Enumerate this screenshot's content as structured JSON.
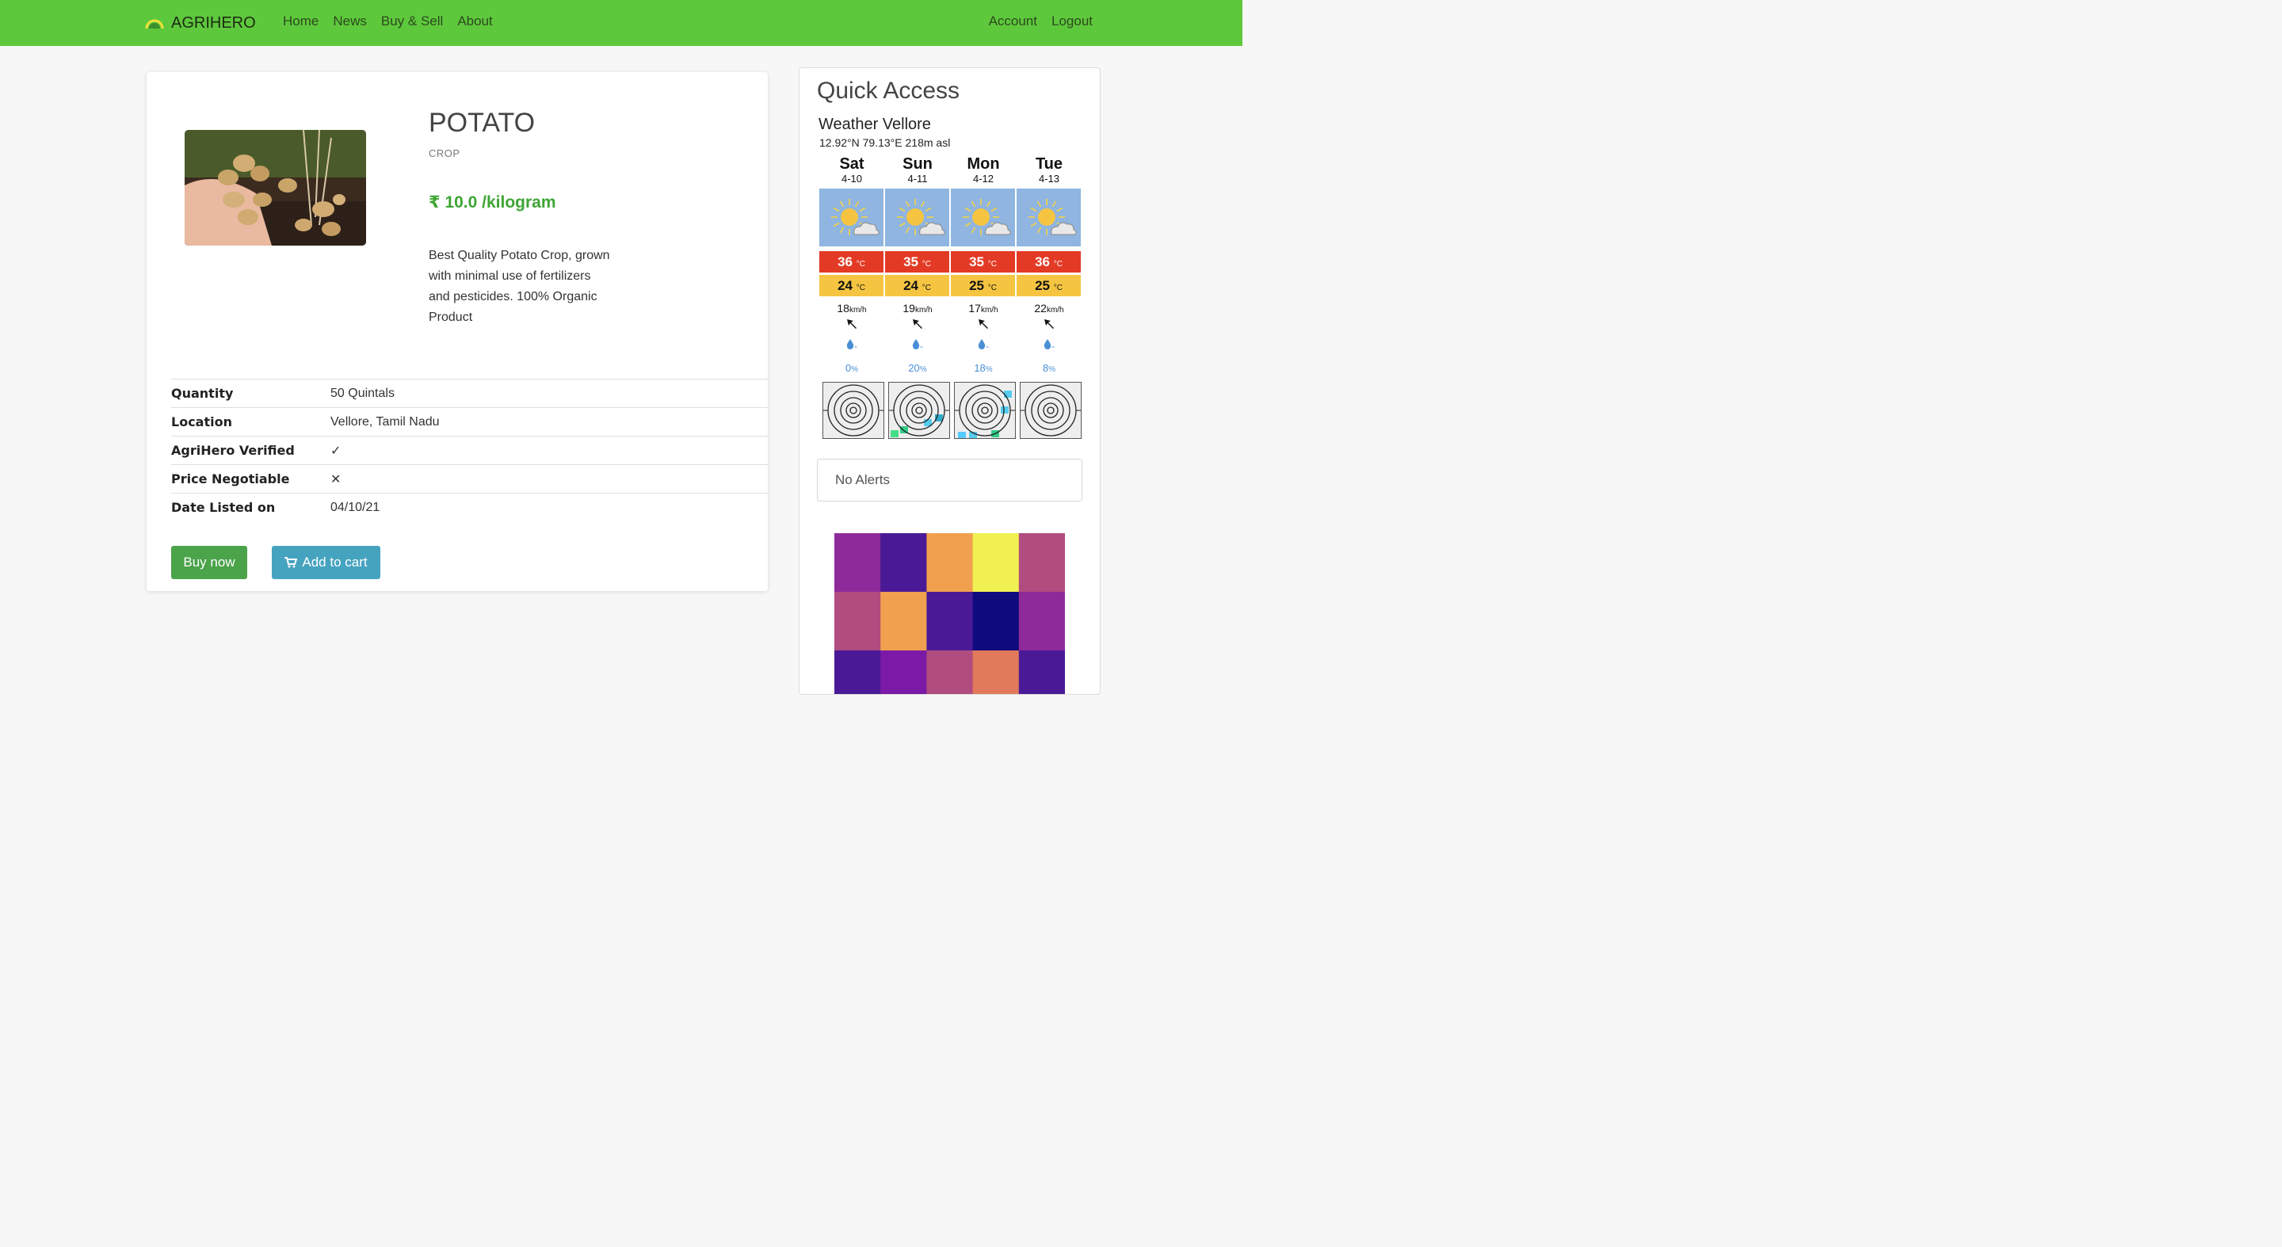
{
  "nav": {
    "brand": "AGRIHERO",
    "links": [
      "Home",
      "News",
      "Buy & Sell",
      "About"
    ],
    "right_links": [
      "Account",
      "Logout"
    ],
    "bg_color": "#5ec83d"
  },
  "product": {
    "name": "POTATO",
    "category": "CROP",
    "price": "₹ 10.0 /kilogram",
    "description": "Best Quality Potato Crop, grown with minimal use of fertilizers and pesticides. 100% Organic Product",
    "details": [
      {
        "key": "Quantity",
        "value": "50 Quintals"
      },
      {
        "key": "Location",
        "value": "Vellore, Tamil Nadu"
      },
      {
        "key": "AgriHero Verified",
        "value": "✓"
      },
      {
        "key": "Price Negotiable",
        "value": "✕"
      },
      {
        "key": "Date Listed on",
        "value": "04/10/21"
      }
    ],
    "buy_label": "Buy now",
    "cart_label": "Add to cart",
    "cart_icon": "shopping-cart-icon"
  },
  "quick_access": {
    "title": "Quick Access",
    "weather": {
      "title": "Weather Vellore",
      "coords": "12.92°N 79.13°E 218m asl",
      "temp_unit": "°C",
      "wind_unit": "km/h",
      "precip_unit": "%",
      "precip_amount": "-",
      "days": [
        {
          "day": "Sat",
          "date": "4-10",
          "max": "36",
          "min": "24",
          "wind": "18",
          "precip": "0",
          "icon": "partly-cloudy-sun-icon"
        },
        {
          "day": "Sun",
          "date": "4-11",
          "max": "35",
          "min": "24",
          "wind": "19",
          "precip": "20",
          "icon": "partly-cloudy-sun-icon"
        },
        {
          "day": "Mon",
          "date": "4-12",
          "max": "35",
          "min": "25",
          "wind": "17",
          "precip": "18",
          "icon": "partly-cloudy-sun-icon"
        },
        {
          "day": "Tue",
          "date": "4-13",
          "max": "36",
          "min": "25",
          "wind": "22",
          "precip": "8",
          "icon": "partly-cloudy-sun-icon"
        }
      ]
    },
    "alerts": "No Alerts",
    "heatmap_colors": [
      [
        "#8f2a9a",
        "#4a1a96",
        "#f0a04e",
        "#f0f052",
        "#b04c7e"
      ],
      [
        "#b04c7e",
        "#f0a04e",
        "#4a1a96",
        "#0f0a7e",
        "#8f2a9a"
      ],
      [
        "#4a1a96",
        "#7a1aa6",
        "#b04c7e",
        "#e07a5a",
        "#4a1a96"
      ]
    ]
  }
}
